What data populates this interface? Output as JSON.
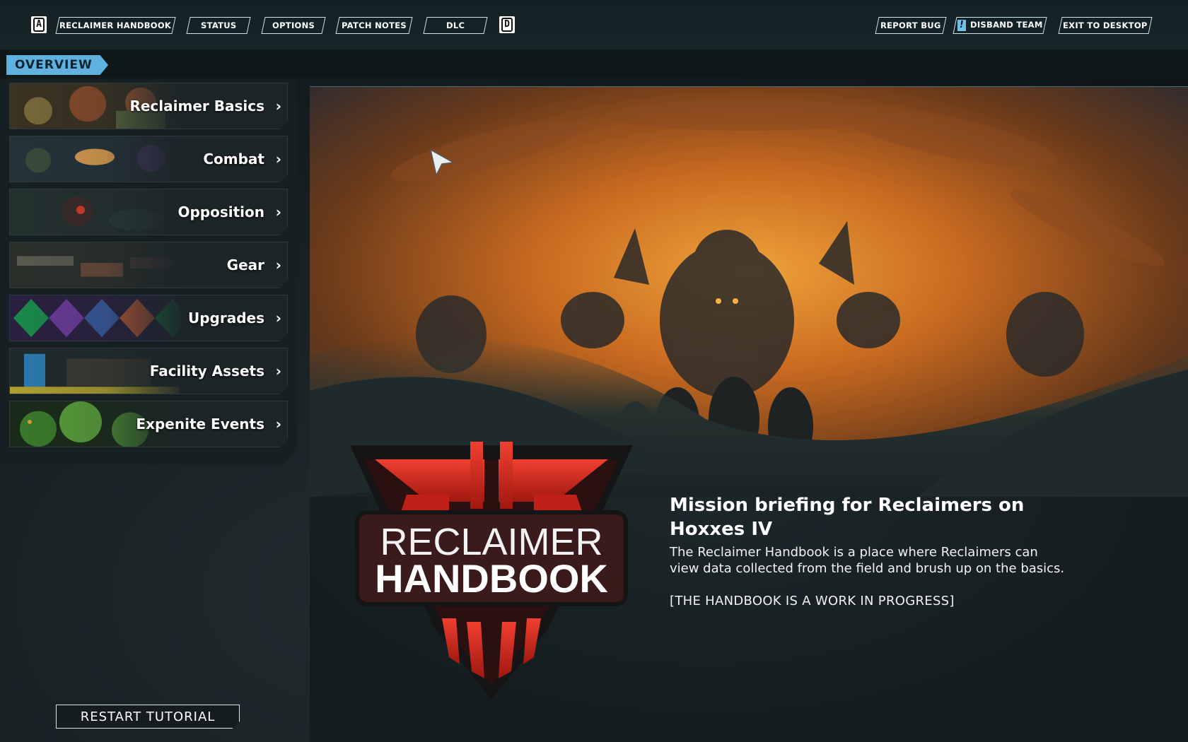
{
  "topbar": {
    "key_left": "A",
    "key_right": "D",
    "tabs": [
      {
        "label": "RECLAIMER HANDBOOK"
      },
      {
        "label": "STATUS"
      },
      {
        "label": "OPTIONS"
      },
      {
        "label": "PATCH NOTES"
      },
      {
        "label": "DLC"
      }
    ],
    "actions": {
      "report_bug": "REPORT BUG",
      "disband_team": "DISBAND TEAM",
      "exit": "EXIT TO DESKTOP"
    }
  },
  "overview": {
    "label": "OVERVIEW"
  },
  "categories": [
    {
      "label": "Reclaimer Basics"
    },
    {
      "label": "Combat"
    },
    {
      "label": "Opposition"
    },
    {
      "label": "Gear"
    },
    {
      "label": "Upgrades"
    },
    {
      "label": "Facility Assets"
    },
    {
      "label": "Expenite Events"
    }
  ],
  "logo": {
    "line1": "RECLAIMER",
    "line2": "HANDBOOK"
  },
  "briefing": {
    "title": "Mission briefing for Reclaimers on Hoxxes IV",
    "description": "The Reclaimer Handbook is a place where Reclaimers can view data collected from the field and brush up on the basics.",
    "wip": "[THE HANDBOOK IS A WORK IN PROGRESS]"
  },
  "footer": {
    "restart_label": "RESTART TUTORIAL"
  },
  "colors": {
    "accent": "#5fb1e0",
    "logo_red": "#d8281e"
  }
}
